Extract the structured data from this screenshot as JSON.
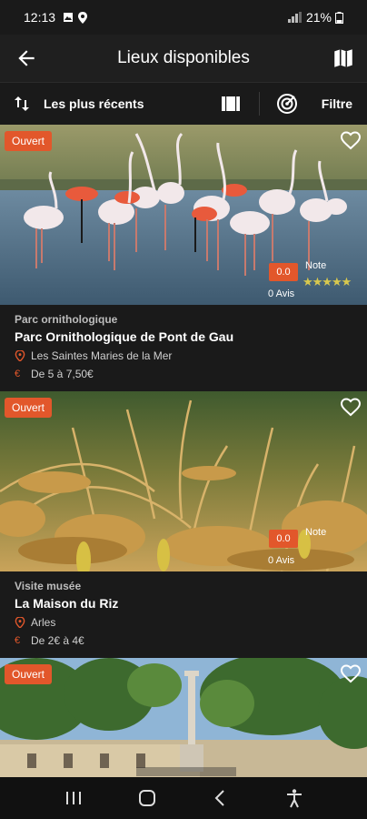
{
  "status": {
    "time": "12:13",
    "battery": "21%"
  },
  "header": {
    "title": "Lieux disponibles"
  },
  "toolbar": {
    "sort_label": "Les plus récents",
    "filter_label": "Filtre"
  },
  "places": [
    {
      "status": "Ouvert",
      "category": "Parc ornithologique",
      "name": "Parc Ornithologique de Pont de Gau",
      "location": "Les Saintes Maries de la Mer",
      "price": "De 5 à 7,50€",
      "rating": "0.0",
      "note_label": "Note",
      "reviews": "0 Avis"
    },
    {
      "status": "Ouvert",
      "category": "Visite musée",
      "name": "La Maison du Riz",
      "location": "Arles",
      "price": "De 2€ à 4€",
      "rating": "0.0",
      "note_label": "Note",
      "reviews": "0 Avis"
    },
    {
      "status": "Ouvert"
    }
  ],
  "colors": {
    "accent": "#e2572b",
    "background": "#1a1a1a"
  }
}
